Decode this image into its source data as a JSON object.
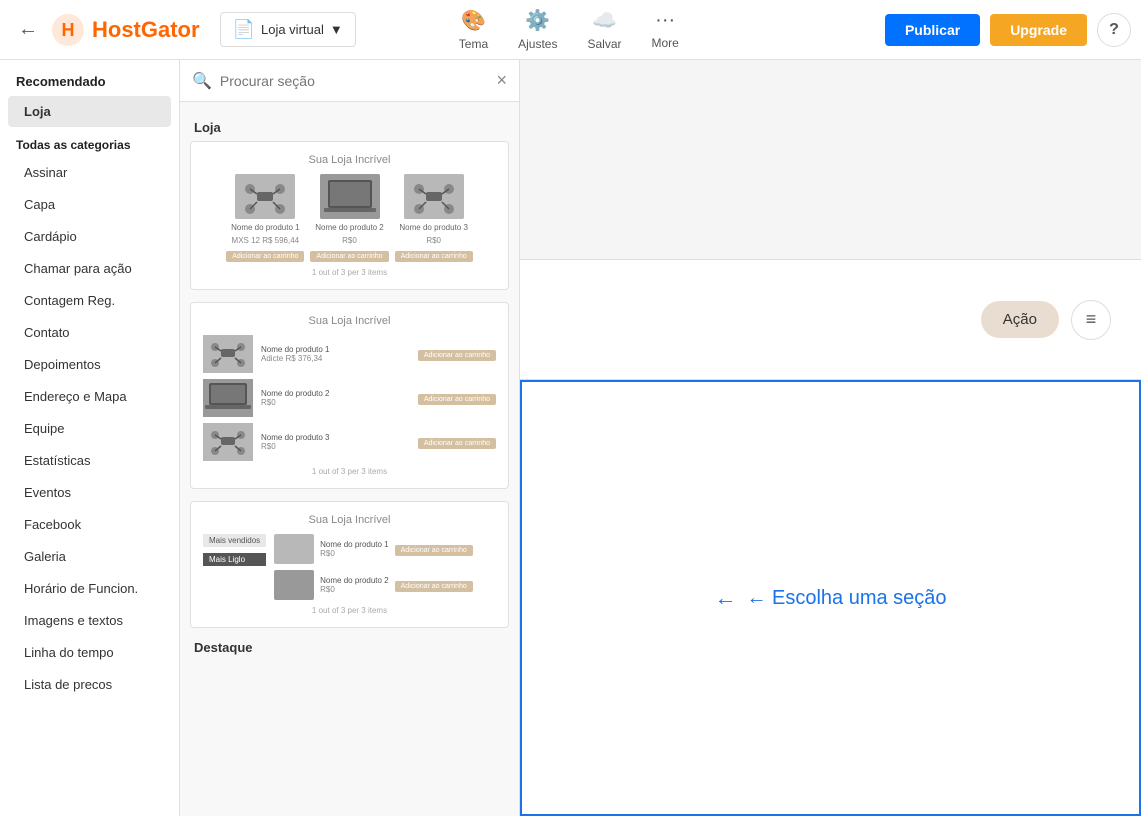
{
  "topNav": {
    "logoText": "HostGator",
    "storeLabel": "Loja virtual",
    "centerItems": [
      {
        "icon": "🎨",
        "label": "Tema"
      },
      {
        "icon": "⚙️",
        "label": "Ajustes"
      },
      {
        "icon": "☁️",
        "label": "Salvar"
      },
      {
        "icon": "···",
        "label": "More"
      }
    ],
    "publicarLabel": "Publicar",
    "upgradeLabel": "Upgrade",
    "helpLabel": "?"
  },
  "leftSidebar": {
    "recommendedTitle": "Recomendado",
    "lojaLabel": "Loja",
    "categoriesTitle": "Todas as categorias",
    "categories": [
      "Assinar",
      "Capa",
      "Cardápio",
      "Chamar para ação",
      "Contagem Reg.",
      "Contato",
      "Depoimentos",
      "Endereço e Mapa",
      "Equipe",
      "Estatísticas",
      "Eventos",
      "Facebook",
      "Galeria",
      "Horário de Funcion.",
      "Imagens e textos",
      "Linha do tempo",
      "Lista de precos"
    ]
  },
  "panel": {
    "searchPlaceholder": "Procurar seção",
    "closeLabel": "×",
    "sectionLabel1": "Loja",
    "sectionLabel2": "Destaque",
    "templates": [
      {
        "title": "Sua Loja Incrível",
        "type": "grid",
        "products": [
          {
            "name": "Nome do produto 1",
            "price": "MXS 12  R$ 596,44",
            "img": "drone"
          },
          {
            "name": "Nome do produto 2",
            "price": "R$0",
            "img": "laptop"
          },
          {
            "name": "Nome do produto 3",
            "price": "R$0",
            "img": "drone"
          }
        ],
        "pagination": "1 out of 3 per 3 items"
      },
      {
        "title": "Sua Loja Incrível",
        "type": "list",
        "products": [
          {
            "name": "Nome do produto 1",
            "price": "Adicte R$ 376,34",
            "img": "drone"
          },
          {
            "name": "Nome do produto 2",
            "price": "R$0",
            "img": "laptop"
          },
          {
            "name": "Nome do produto 3",
            "price": "R$0",
            "img": "drone"
          }
        ],
        "pagination": "1 out of 3 per 3 items"
      },
      {
        "title": "Sua Loja Incrível",
        "type": "featured",
        "tags": [
          "Mais vendidos",
          "Mais Liglo"
        ],
        "products": [
          {
            "name": "Nome do produto 1",
            "price": "R$0"
          },
          {
            "name": "Nome do produto 2",
            "price": "R$0"
          }
        ],
        "pagination": "1 out of 3 per 3 items"
      }
    ]
  },
  "canvas": {
    "actionLabel": "Ação",
    "menuLabel": "≡",
    "chooseSectionLabel": "← Escolha uma seção"
  }
}
